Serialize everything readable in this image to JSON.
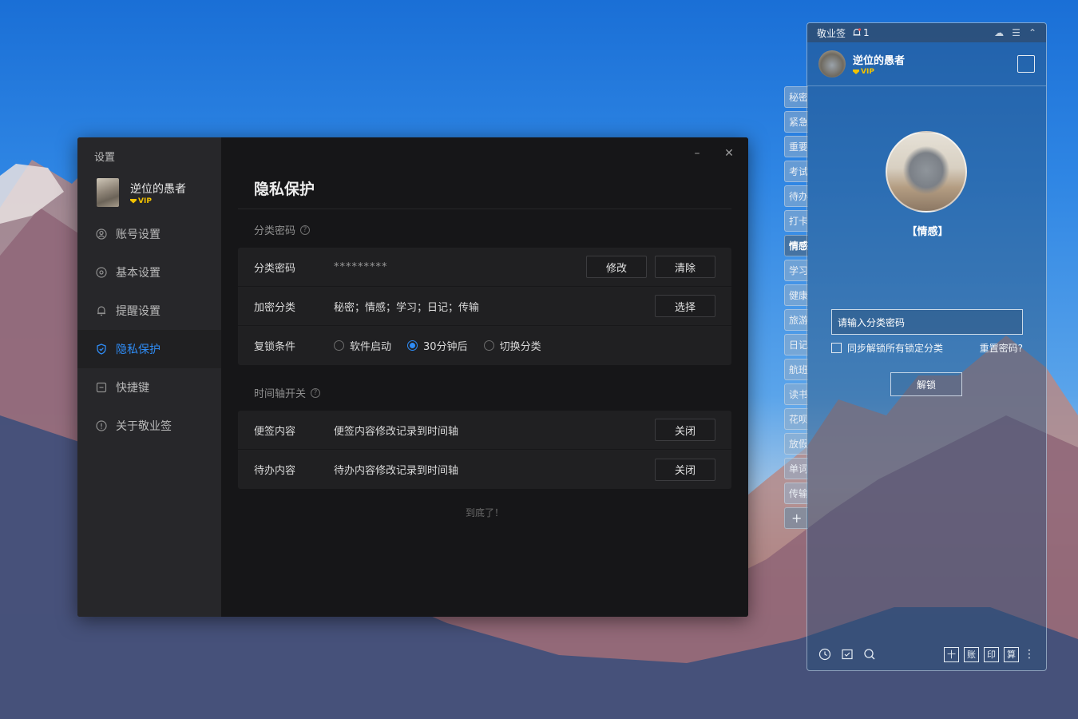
{
  "settings": {
    "window_title": "设置",
    "user": {
      "name": "逆位的愚者",
      "badge": "VIP"
    },
    "nav": [
      {
        "label": "账号设置",
        "icon": "user-circle-icon"
      },
      {
        "label": "基本设置",
        "icon": "gear-icon"
      },
      {
        "label": "提醒设置",
        "icon": "bell-icon"
      },
      {
        "label": "隐私保护",
        "icon": "shield-icon",
        "active": true
      },
      {
        "label": "快捷键",
        "icon": "keyboard-icon"
      },
      {
        "label": "关于敬业签",
        "icon": "info-icon"
      }
    ],
    "window_buttons": {
      "minimize": "–",
      "close": "✕"
    },
    "page_title": "隐私保护",
    "category_section": {
      "title": "分类密码",
      "help": "?",
      "password_row": {
        "label": "分类密码",
        "value": "*********",
        "modify": "修改",
        "clear": "清除"
      },
      "encrypted_row": {
        "label": "加密分类",
        "value": "秘密；情感；学习；日记；传输",
        "select": "选择"
      },
      "relock_row": {
        "label": "复锁条件",
        "options": [
          "软件启动",
          "30分钟后",
          "切换分类"
        ],
        "selected": "30分钟后"
      }
    },
    "timeline_section": {
      "title": "时间轴开关",
      "help": "?",
      "rows": [
        {
          "label": "便签内容",
          "value": "便签内容修改记录到时间轴",
          "button": "关闭"
        },
        {
          "label": "待办内容",
          "value": "待办内容修改记录到时间轴",
          "button": "关闭"
        }
      ]
    },
    "end_note": "到底了！"
  },
  "side_tabs": [
    "秘密",
    "紧急",
    "重要",
    "考试",
    "待办",
    "打卡",
    "情感",
    "学习",
    "健康",
    "旅游",
    "日记",
    "航班",
    "读书",
    "花呗",
    "放假",
    "单词",
    "传输"
  ],
  "side_tabs_active": "情感",
  "side_tabs_add": "+",
  "widget": {
    "app_name": "敬业签",
    "notification_count": "1",
    "user": {
      "name": "逆位的愚者",
      "badge": "VIP"
    },
    "category": "【情感】",
    "password_placeholder": "请输入分类密码",
    "sync_label": "同步解锁所有锁定分类",
    "reset_link": "重置密码?",
    "unlock_button": "解锁",
    "bottom_tools": [
      "十",
      "账",
      "印",
      "算"
    ]
  },
  "colors": {
    "accent": "#2f8cf5",
    "vip": "#f2c200"
  }
}
